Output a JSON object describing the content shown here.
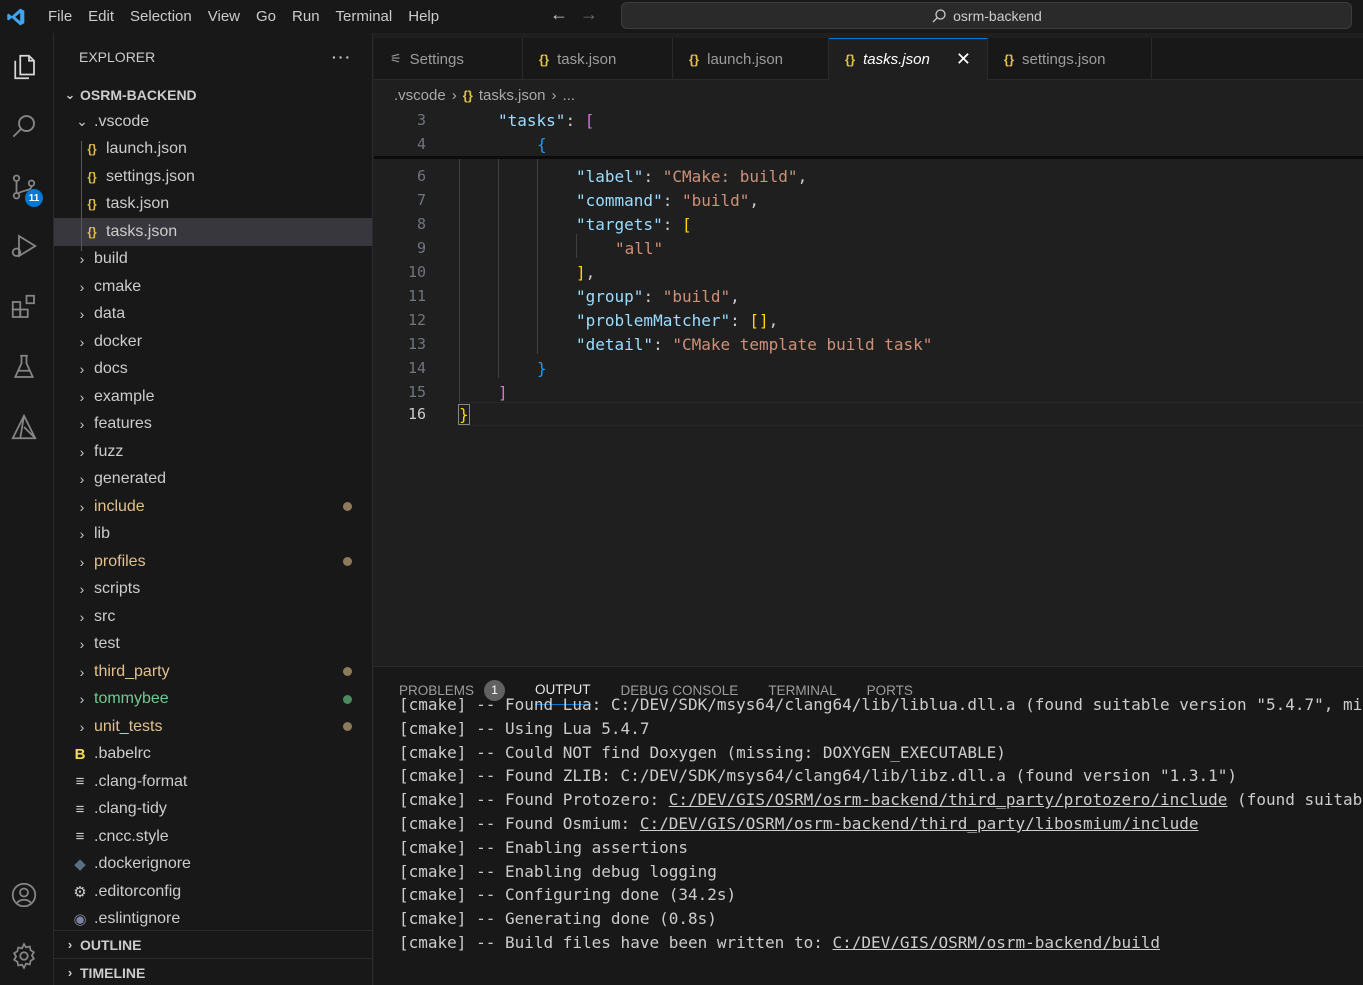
{
  "menu": [
    "File",
    "Edit",
    "Selection",
    "View",
    "Go",
    "Run",
    "Terminal",
    "Help"
  ],
  "command_center": "osrm-backend",
  "activity": {
    "scm_badge": "11"
  },
  "explorer": {
    "title": "EXPLORER",
    "more": "···",
    "root": "OSRM-BACKEND",
    "vscode_folder": ".vscode",
    "vscode_files": [
      "launch.json",
      "settings.json",
      "task.json",
      "tasks.json"
    ],
    "folders": [
      {
        "name": "build",
        "color": "#cccccc",
        "dot": ""
      },
      {
        "name": "cmake",
        "color": "#cccccc",
        "dot": ""
      },
      {
        "name": "data",
        "color": "#cccccc",
        "dot": ""
      },
      {
        "name": "docker",
        "color": "#cccccc",
        "dot": ""
      },
      {
        "name": "docs",
        "color": "#cccccc",
        "dot": ""
      },
      {
        "name": "example",
        "color": "#cccccc",
        "dot": ""
      },
      {
        "name": "features",
        "color": "#cccccc",
        "dot": ""
      },
      {
        "name": "fuzz",
        "color": "#cccccc",
        "dot": ""
      },
      {
        "name": "generated",
        "color": "#cccccc",
        "dot": ""
      },
      {
        "name": "include",
        "color": "#e2c08d",
        "dot": "#8c7a5a"
      },
      {
        "name": "lib",
        "color": "#cccccc",
        "dot": ""
      },
      {
        "name": "profiles",
        "color": "#e2c08d",
        "dot": "#8c7a5a"
      },
      {
        "name": "scripts",
        "color": "#cccccc",
        "dot": ""
      },
      {
        "name": "src",
        "color": "#cccccc",
        "dot": ""
      },
      {
        "name": "test",
        "color": "#cccccc",
        "dot": ""
      },
      {
        "name": "third_party",
        "color": "#e2c08d",
        "dot": "#8c7a5a"
      },
      {
        "name": "tommybee",
        "color": "#73c991",
        "dot": "#4a8a5e"
      },
      {
        "name": "unit_tests",
        "color": "#e2c08d",
        "dot": "#8c7a5a"
      }
    ],
    "files": [
      {
        "name": ".babelrc",
        "icon": "B",
        "icon_color": "#f5da55"
      },
      {
        "name": ".clang-format",
        "icon": "≡",
        "icon_color": "#cccccc"
      },
      {
        "name": ".clang-tidy",
        "icon": "≡",
        "icon_color": "#cccccc"
      },
      {
        "name": ".cncc.style",
        "icon": "≡",
        "icon_color": "#cccccc"
      },
      {
        "name": ".dockerignore",
        "icon": "◆",
        "icon_color": "#5c6e82"
      },
      {
        "name": ".editorconfig",
        "icon": "⚙",
        "icon_color": "#cccccc"
      },
      {
        "name": ".eslintignore",
        "icon": "◉",
        "icon_color": "#8080a0"
      }
    ],
    "outline": "OUTLINE",
    "timeline": "TIMELINE"
  },
  "tabs": [
    {
      "label": "Settings",
      "icon": "⚟",
      "active": false
    },
    {
      "label": "task.json",
      "icon": "{}",
      "active": false
    },
    {
      "label": "launch.json",
      "icon": "{}",
      "active": false
    },
    {
      "label": "tasks.json",
      "icon": "{}",
      "active": true
    },
    {
      "label": "settings.json",
      "icon": "{}",
      "active": false
    }
  ],
  "breadcrumb": {
    "folder": ".vscode",
    "file": "tasks.json",
    "rest": "..."
  },
  "editor": {
    "line_numbers": [
      "3",
      "4",
      "6",
      "7",
      "8",
      "9",
      "10",
      "11",
      "12",
      "13",
      "14",
      "15",
      "16"
    ],
    "current_line": "16"
  },
  "panel": {
    "tabs": [
      "PROBLEMS",
      "OUTPUT",
      "DEBUG CONSOLE",
      "TERMINAL",
      "PORTS"
    ],
    "problems_count": "1",
    "output_lines": [
      {
        "text": "[cmake] -- Found Lua: C:/DEV/SDK/msys64/clang64/lib/liblua.dll.a (found suitable version \"5.4.7\", mi",
        "link": ""
      },
      {
        "text": "[cmake] -- Using Lua 5.4.7",
        "link": ""
      },
      {
        "text": "[cmake] -- Could NOT find Doxygen (missing: DOXYGEN_EXECUTABLE)",
        "link": ""
      },
      {
        "text": "[cmake] -- Found ZLIB: C:/DEV/SDK/msys64/clang64/lib/libz.dll.a (found version \"1.3.1\")",
        "link": ""
      },
      {
        "text": "[cmake] -- Found Protozero: ",
        "link": "C:/DEV/GIS/OSRM/osrm-backend/third_party/protozero/include",
        "after": " (found suitab"
      },
      {
        "text": "[cmake] -- Found Osmium: ",
        "link": "C:/DEV/GIS/OSRM/osrm-backend/third_party/libosmium/include",
        "after": ""
      },
      {
        "text": "[cmake] -- Enabling assertions",
        "link": ""
      },
      {
        "text": "[cmake] -- Enabling debug logging",
        "link": ""
      },
      {
        "text": "[cmake] -- Configuring done (34.2s)",
        "link": ""
      },
      {
        "text": "[cmake] -- Generating done (0.8s)",
        "link": ""
      },
      {
        "text": "[cmake] -- Build files have been written to: ",
        "link": "C:/DEV/GIS/OSRM/osrm-backend/build",
        "after": ""
      }
    ]
  }
}
